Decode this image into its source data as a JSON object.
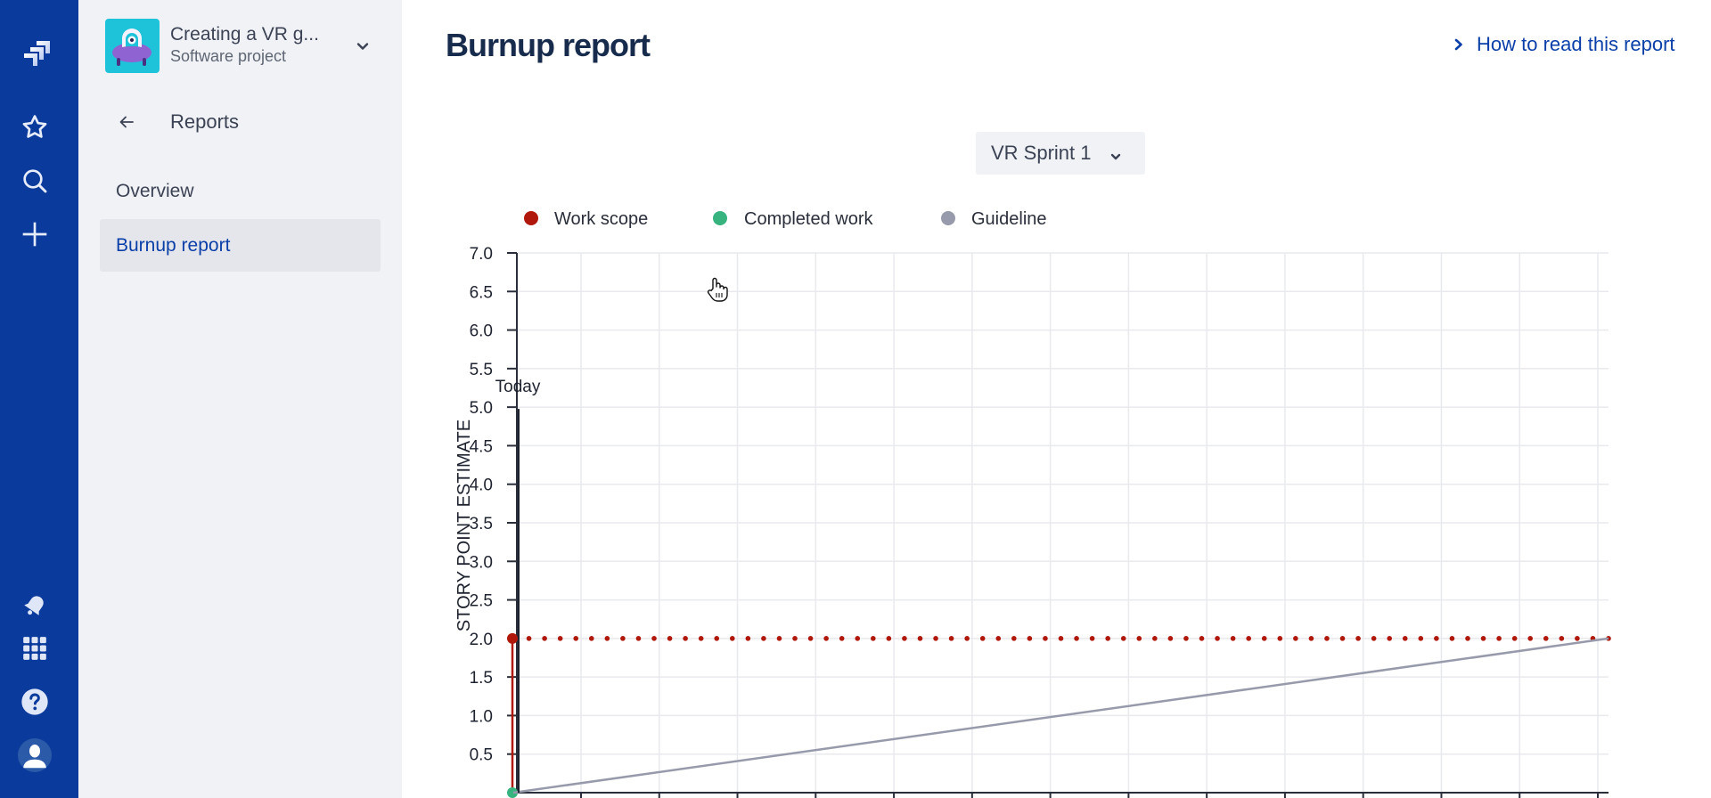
{
  "global_nav": {
    "top_icons": [
      "jira-logo-icon",
      "starred-icon",
      "search-icon",
      "create-icon"
    ],
    "bottom_icons": [
      "notifications-icon",
      "app-switcher-icon",
      "help-icon",
      "profile-icon"
    ]
  },
  "project": {
    "name": "Creating a VR g...",
    "type": "Software project"
  },
  "sidebar": {
    "section_title": "Reports",
    "items": [
      {
        "label": "Overview",
        "active": false
      },
      {
        "label": "Burnup report",
        "active": true
      }
    ]
  },
  "main": {
    "title": "Burnup report",
    "help_link": "How to read this report",
    "sprint_select": "VR Sprint 1"
  },
  "colors": {
    "nav_bg": "#0a3a9c",
    "link": "#0b3fa8",
    "work_scope": "#b0180c",
    "completed_work": "#36b37e",
    "guideline": "#979aab",
    "grid": "#e9eaee",
    "axis": "#2a2e3a"
  },
  "chart_data": {
    "type": "line",
    "title": "",
    "xlabel": "",
    "ylabel": "STORY POINT ESTIMATE",
    "ylim": [
      0,
      7
    ],
    "y_ticks": [
      "0.5",
      "1.0",
      "1.5",
      "2.0",
      "2.5",
      "3.0",
      "3.5",
      "4.0",
      "4.5",
      "5.0",
      "5.5",
      "6.0",
      "6.5",
      "7.0"
    ],
    "y_tick_values": [
      0.5,
      1.0,
      1.5,
      2.0,
      2.5,
      3.0,
      3.5,
      4.0,
      4.5,
      5.0,
      5.5,
      6.0,
      6.5,
      7.0
    ],
    "x_divisions": 14,
    "grid": true,
    "legend": {
      "placement": "top-left",
      "entries": [
        {
          "name": "Work scope",
          "color": "#b0180c"
        },
        {
          "name": "Completed work",
          "color": "#36b37e"
        },
        {
          "name": "Guideline",
          "color": "#979aab"
        }
      ]
    },
    "series": [
      {
        "name": "Work scope",
        "style": "step-then-dotted",
        "points": [
          [
            0,
            0
          ],
          [
            0,
            2
          ],
          [
            14,
            2
          ]
        ]
      },
      {
        "name": "Completed work",
        "style": "marker",
        "points": [
          [
            0,
            0
          ]
        ]
      },
      {
        "name": "Guideline",
        "style": "solid",
        "points": [
          [
            0,
            0
          ],
          [
            14,
            2
          ]
        ]
      }
    ],
    "annotations": [
      {
        "label": "Today",
        "x": 0.06,
        "y_top": 5.0
      }
    ]
  }
}
